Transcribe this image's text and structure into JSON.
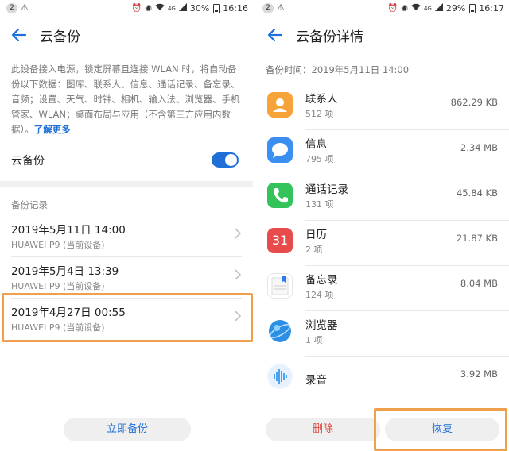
{
  "left": {
    "status": {
      "badge": "2",
      "notif": "⚠",
      "network": "4G",
      "battery": "30%",
      "battery_level": 0.3,
      "time": "16:16"
    },
    "title": "云备份",
    "description": "此设备接入电源，锁定屏幕且连接 WLAN 时，将自动备份以下数据：图库、联系人、信息、通话记录、备忘录、音频；设置、天气、时钟、相机、输入法、浏览器、手机管家、WLAN；桌面布局与应用（不含第三方应用内数据）。",
    "learn_more": "了解更多",
    "toggle_label": "云备份",
    "toggle_on": true,
    "section_label": "备份记录",
    "records": [
      {
        "title": "2019年5月11日 14:00",
        "device": "HUAWEI P9 (当前设备)"
      },
      {
        "title": "2019年5月4日 13:39",
        "device": "HUAWEI P9 (当前设备)"
      },
      {
        "title": "2019年4月27日 00:55",
        "device": "HUAWEI P9 (当前设备)"
      }
    ],
    "backup_now": "立即备份"
  },
  "right": {
    "status": {
      "badge": "2",
      "notif": "⚠",
      "network": "4G",
      "battery": "29%",
      "battery_level": 0.29,
      "time": "16:17"
    },
    "title": "云备份详情",
    "backup_time": "备份时间：2019年5月11日 14:00",
    "items": [
      {
        "name": "联系人",
        "count": "512 项",
        "size": "862.29 KB",
        "icon": "contacts-icon",
        "color": "#f6a33a"
      },
      {
        "name": "信息",
        "count": "795 项",
        "size": "2.34 MB",
        "icon": "messages-icon",
        "color": "#3a8ff0"
      },
      {
        "name": "通话记录",
        "count": "131 项",
        "size": "45.84 KB",
        "icon": "phone-icon",
        "color": "#33c35a"
      },
      {
        "name": "日历",
        "count": "2 项",
        "size": "21.87 KB",
        "icon": "calendar-icon",
        "color": "#e84b4b",
        "calendar_day": "31"
      },
      {
        "name": "备忘录",
        "count": "124 项",
        "size": "8.04 MB",
        "icon": "notes-icon",
        "color": "#ffffff"
      },
      {
        "name": "浏览器",
        "count": "1 项",
        "size": "",
        "icon": "browser-icon",
        "color": "#2b8fe6"
      },
      {
        "name": "录音",
        "count": "",
        "size": "3.92 MB",
        "icon": "recorder-icon",
        "color": "#4aa3f0"
      }
    ],
    "delete_label": "删除",
    "restore_label": "恢复"
  },
  "colors": {
    "accent": "#1f6fd9",
    "danger": "#e0443c",
    "highlight": "#f0a04c"
  }
}
